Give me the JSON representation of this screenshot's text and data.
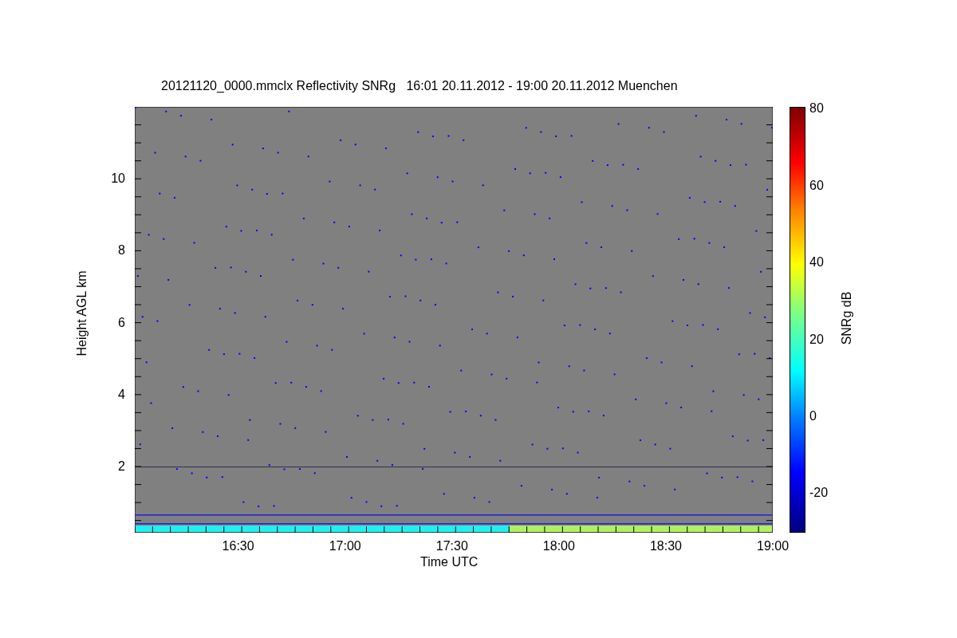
{
  "title": "20121120_0000.mmclx Reflectivity SNRg   16:01 20.11.2012 - 19:00 20.11.2012 Muenchen",
  "y_axis": {
    "label": "Height AGL km",
    "ticks": [
      "10",
      "8",
      "6",
      "4",
      "2"
    ]
  },
  "x_axis": {
    "label": "Time UTC",
    "ticks": [
      "16:30",
      "17:00",
      "17:30",
      "18:00",
      "18:30",
      "19:00"
    ]
  },
  "colorbar": {
    "label": "SNRg dB",
    "ticks": [
      "80",
      "60",
      "40",
      "20",
      "0",
      "-20"
    ]
  }
}
